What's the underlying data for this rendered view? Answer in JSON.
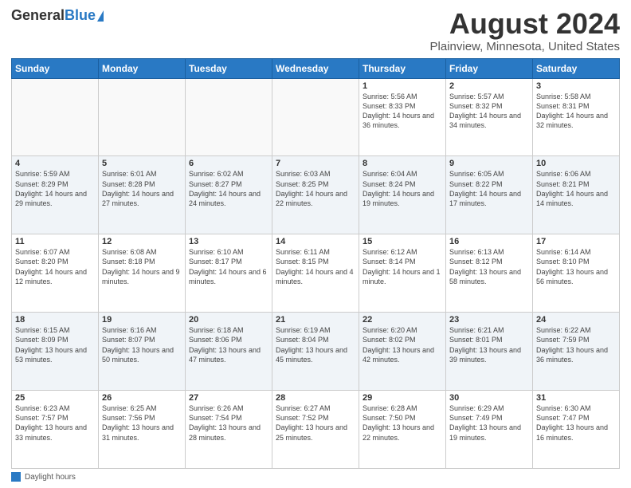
{
  "header": {
    "logo_general": "General",
    "logo_blue": "Blue",
    "title": "August 2024",
    "subtitle": "Plainview, Minnesota, United States"
  },
  "calendar": {
    "days_of_week": [
      "Sunday",
      "Monday",
      "Tuesday",
      "Wednesday",
      "Thursday",
      "Friday",
      "Saturday"
    ],
    "weeks": [
      [
        {
          "day": "",
          "info": ""
        },
        {
          "day": "",
          "info": ""
        },
        {
          "day": "",
          "info": ""
        },
        {
          "day": "",
          "info": ""
        },
        {
          "day": "1",
          "info": "Sunrise: 5:56 AM\nSunset: 8:33 PM\nDaylight: 14 hours and 36 minutes."
        },
        {
          "day": "2",
          "info": "Sunrise: 5:57 AM\nSunset: 8:32 PM\nDaylight: 14 hours and 34 minutes."
        },
        {
          "day": "3",
          "info": "Sunrise: 5:58 AM\nSunset: 8:31 PM\nDaylight: 14 hours and 32 minutes."
        }
      ],
      [
        {
          "day": "4",
          "info": "Sunrise: 5:59 AM\nSunset: 8:29 PM\nDaylight: 14 hours and 29 minutes."
        },
        {
          "day": "5",
          "info": "Sunrise: 6:01 AM\nSunset: 8:28 PM\nDaylight: 14 hours and 27 minutes."
        },
        {
          "day": "6",
          "info": "Sunrise: 6:02 AM\nSunset: 8:27 PM\nDaylight: 14 hours and 24 minutes."
        },
        {
          "day": "7",
          "info": "Sunrise: 6:03 AM\nSunset: 8:25 PM\nDaylight: 14 hours and 22 minutes."
        },
        {
          "day": "8",
          "info": "Sunrise: 6:04 AM\nSunset: 8:24 PM\nDaylight: 14 hours and 19 minutes."
        },
        {
          "day": "9",
          "info": "Sunrise: 6:05 AM\nSunset: 8:22 PM\nDaylight: 14 hours and 17 minutes."
        },
        {
          "day": "10",
          "info": "Sunrise: 6:06 AM\nSunset: 8:21 PM\nDaylight: 14 hours and 14 minutes."
        }
      ],
      [
        {
          "day": "11",
          "info": "Sunrise: 6:07 AM\nSunset: 8:20 PM\nDaylight: 14 hours and 12 minutes."
        },
        {
          "day": "12",
          "info": "Sunrise: 6:08 AM\nSunset: 8:18 PM\nDaylight: 14 hours and 9 minutes."
        },
        {
          "day": "13",
          "info": "Sunrise: 6:10 AM\nSunset: 8:17 PM\nDaylight: 14 hours and 6 minutes."
        },
        {
          "day": "14",
          "info": "Sunrise: 6:11 AM\nSunset: 8:15 PM\nDaylight: 14 hours and 4 minutes."
        },
        {
          "day": "15",
          "info": "Sunrise: 6:12 AM\nSunset: 8:14 PM\nDaylight: 14 hours and 1 minute."
        },
        {
          "day": "16",
          "info": "Sunrise: 6:13 AM\nSunset: 8:12 PM\nDaylight: 13 hours and 58 minutes."
        },
        {
          "day": "17",
          "info": "Sunrise: 6:14 AM\nSunset: 8:10 PM\nDaylight: 13 hours and 56 minutes."
        }
      ],
      [
        {
          "day": "18",
          "info": "Sunrise: 6:15 AM\nSunset: 8:09 PM\nDaylight: 13 hours and 53 minutes."
        },
        {
          "day": "19",
          "info": "Sunrise: 6:16 AM\nSunset: 8:07 PM\nDaylight: 13 hours and 50 minutes."
        },
        {
          "day": "20",
          "info": "Sunrise: 6:18 AM\nSunset: 8:06 PM\nDaylight: 13 hours and 47 minutes."
        },
        {
          "day": "21",
          "info": "Sunrise: 6:19 AM\nSunset: 8:04 PM\nDaylight: 13 hours and 45 minutes."
        },
        {
          "day": "22",
          "info": "Sunrise: 6:20 AM\nSunset: 8:02 PM\nDaylight: 13 hours and 42 minutes."
        },
        {
          "day": "23",
          "info": "Sunrise: 6:21 AM\nSunset: 8:01 PM\nDaylight: 13 hours and 39 minutes."
        },
        {
          "day": "24",
          "info": "Sunrise: 6:22 AM\nSunset: 7:59 PM\nDaylight: 13 hours and 36 minutes."
        }
      ],
      [
        {
          "day": "25",
          "info": "Sunrise: 6:23 AM\nSunset: 7:57 PM\nDaylight: 13 hours and 33 minutes."
        },
        {
          "day": "26",
          "info": "Sunrise: 6:25 AM\nSunset: 7:56 PM\nDaylight: 13 hours and 31 minutes."
        },
        {
          "day": "27",
          "info": "Sunrise: 6:26 AM\nSunset: 7:54 PM\nDaylight: 13 hours and 28 minutes."
        },
        {
          "day": "28",
          "info": "Sunrise: 6:27 AM\nSunset: 7:52 PM\nDaylight: 13 hours and 25 minutes."
        },
        {
          "day": "29",
          "info": "Sunrise: 6:28 AM\nSunset: 7:50 PM\nDaylight: 13 hours and 22 minutes."
        },
        {
          "day": "30",
          "info": "Sunrise: 6:29 AM\nSunset: 7:49 PM\nDaylight: 13 hours and 19 minutes."
        },
        {
          "day": "31",
          "info": "Sunrise: 6:30 AM\nSunset: 7:47 PM\nDaylight: 13 hours and 16 minutes."
        }
      ]
    ]
  },
  "footer": {
    "daylight_label": "Daylight hours"
  }
}
